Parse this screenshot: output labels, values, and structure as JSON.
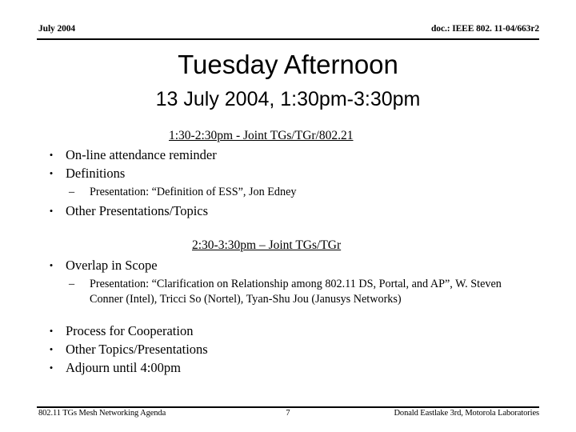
{
  "header": {
    "left": "July 2004",
    "right": "doc.: IEEE 802. 11-04/663r2"
  },
  "title": "Tuesday Afternoon",
  "subtitle": "13 July 2004, 1:30pm-3:30pm",
  "sections": [
    {
      "heading": "1:30-2:30pm - Joint TGs/TGr/802.21",
      "items": [
        {
          "level": 1,
          "text": "On-line attendance reminder"
        },
        {
          "level": 1,
          "text": "Definitions"
        },
        {
          "level": 2,
          "text": "Presentation: “Definition of ESS”, Jon Edney"
        },
        {
          "level": 1,
          "text": "Other Presentations/Topics"
        }
      ]
    },
    {
      "heading": "2:30-3:30pm – Joint TGs/TGr",
      "items": [
        {
          "level": 1,
          "text": "Overlap in Scope"
        },
        {
          "level": 2,
          "text": "Presentation: “Clarification on Relationship among 802.11 DS, Portal, and AP”, W. Steven Conner (Intel), Tricci So (Nortel), Tyan-Shu Jou (Janusys Networks)"
        },
        {
          "level": 1,
          "text": "Process for Cooperation"
        },
        {
          "level": 1,
          "text": "Other Topics/Presentations"
        },
        {
          "level": 1,
          "text": "Adjourn until 4:00pm"
        }
      ]
    }
  ],
  "bullets": {
    "level1_glyph": "•",
    "level2_glyph": "–"
  },
  "footer": {
    "left": "802.11 TGs Mesh Networking Agenda",
    "page": "7",
    "right": "Donald Eastlake 3rd, Motorola Laboratories"
  }
}
